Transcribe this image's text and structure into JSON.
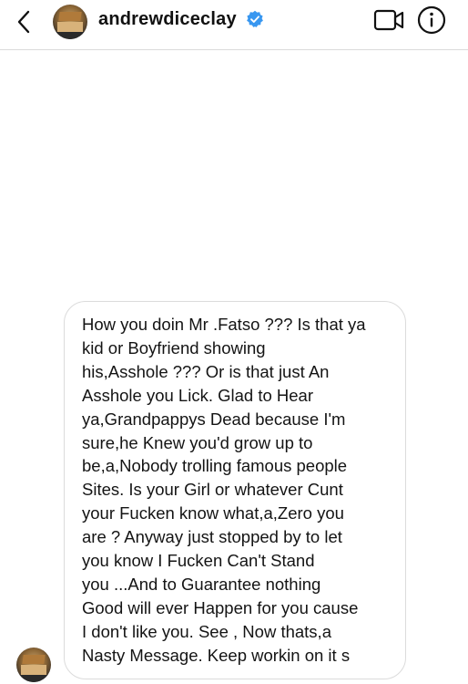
{
  "header": {
    "username": "andrewdiceclay",
    "verified": true,
    "accent_color": "#3897f0"
  },
  "icons": {
    "back": "chevron-left-icon",
    "verified": "verified-badge-icon",
    "video": "video-camera-icon",
    "info": "info-icon"
  },
  "message": {
    "text": "How you doin Mr .Fatso ??? Is that ya\nkid or Boyfriend showing\nhis,Asshole ??? Or is that just An\nAsshole you Lick. Glad to Hear\nya,Grandpappys Dead because I'm\nsure,he Knew you'd grow up to\nbe,a,Nobody trolling famous people\nSites. Is your Girl or whatever Cunt\nyour Fucken know what,a,Zero you\nare ? Anyway just stopped by to let\nyou know I Fucken Can't Stand\nyou ...And to Guarantee nothing\nGood will ever Happen for you cause\nI don't like you. See , Now thats,a\nNasty Message. Keep workin on it s"
  }
}
